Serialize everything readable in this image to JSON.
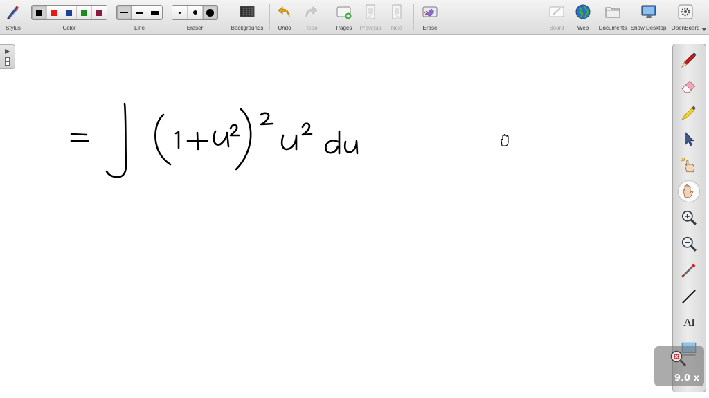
{
  "toolbar": {
    "stylus": "Stylus",
    "color": "Color",
    "line": "Line",
    "eraser": "Eraser",
    "backgrounds": "Backgrounds",
    "undo": "Undo",
    "redo": "Redo",
    "pages": "Pages",
    "previous": "Previous",
    "next": "Next",
    "erase": "Erase",
    "board": "Board",
    "web": "Web",
    "documents": "Documents",
    "show_desktop": "Show Desktop",
    "openboard": "OpenBoard"
  },
  "colors": [
    "#000000",
    "#e81818",
    "#1c3f99",
    "#198c19",
    "#8c1a45"
  ],
  "selected_color_index": 0,
  "line_widths": [
    "thin",
    "medium",
    "thick"
  ],
  "selected_line_index": 0,
  "eraser_sizes": [
    "small",
    "medium",
    "large"
  ],
  "selected_eraser_index": 2,
  "right_tools": [
    {
      "name": "pen-icon"
    },
    {
      "name": "eraser-icon"
    },
    {
      "name": "highlighter-icon"
    },
    {
      "name": "selector-icon"
    },
    {
      "name": "interact-icon"
    },
    {
      "name": "hand-icon",
      "selected": true
    },
    {
      "name": "zoom-in-icon"
    },
    {
      "name": "zoom-out-icon"
    },
    {
      "name": "laser-pointer-icon"
    },
    {
      "name": "line-icon"
    },
    {
      "name": "text-icon",
      "label": "AI"
    },
    {
      "name": "capture-icon"
    }
  ],
  "zoom_level": "9.0 x"
}
